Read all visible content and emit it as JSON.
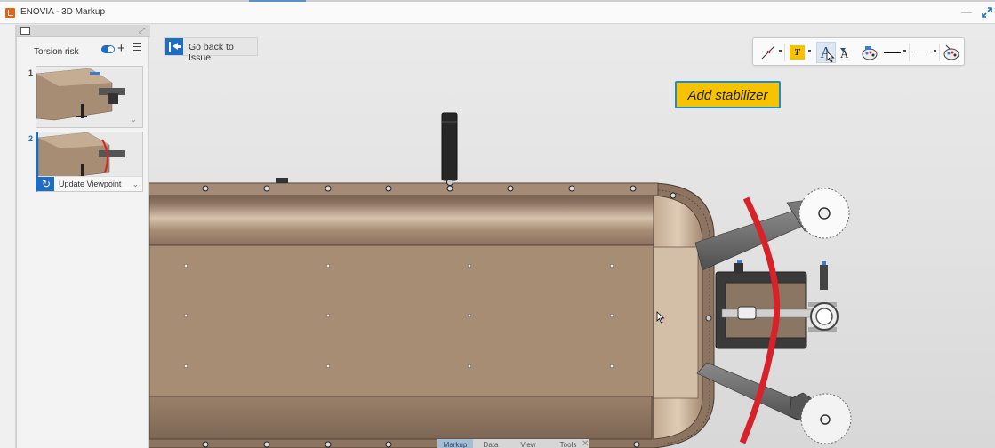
{
  "window": {
    "title": "ENOVIA - 3D Markup",
    "minimize_icon": "minimize-icon",
    "restore_icon": "restore-icon"
  },
  "side_panel": {
    "title": "Torsion risk",
    "toggle_on": true,
    "add_icon": "plus-icon",
    "menu_icon": "hamburger-icon",
    "slides": [
      {
        "number": "1",
        "active": false,
        "expand_icon": "chevron-down-icon"
      },
      {
        "number": "2",
        "active": true,
        "update_label": "Update Viewpoint",
        "update_icon": "refresh-icon",
        "expand_icon": "chevron-down-icon"
      }
    ]
  },
  "go_back": {
    "label": "Go back to Issue",
    "icon": "arrow-to-left-bar-icon"
  },
  "markup_toolbar": {
    "tools": [
      {
        "name": "line-tool",
        "icon": "diagonal-line-icon"
      },
      {
        "name": "text-tool",
        "icon": "text-box-icon",
        "glyph": "T"
      },
      {
        "name": "increase-font-size",
        "icon": "font-increase-icon",
        "glyph": "A",
        "active": true
      },
      {
        "name": "decrease-font-size",
        "icon": "font-decrease-icon",
        "glyph": "A"
      },
      {
        "name": "fill-color",
        "icon": "palette-fill-icon"
      },
      {
        "name": "line-thickness",
        "icon": "line-thick-icon"
      },
      {
        "name": "line-style",
        "icon": "line-thin-icon"
      },
      {
        "name": "text-color",
        "icon": "palette-icon"
      }
    ]
  },
  "callout": {
    "text": "Add stabilizer",
    "background": "#f7c200",
    "border": "#1c8ad6"
  },
  "bottom_tabs": {
    "tabs": [
      "Markup",
      "Data",
      "View",
      "Tools"
    ],
    "active": "Markup",
    "close_icon": "close-icon"
  },
  "colors": {
    "accent_blue": "#1d6ec2",
    "model_bronze": "#a88d75",
    "markup_red": "#d8222a"
  }
}
